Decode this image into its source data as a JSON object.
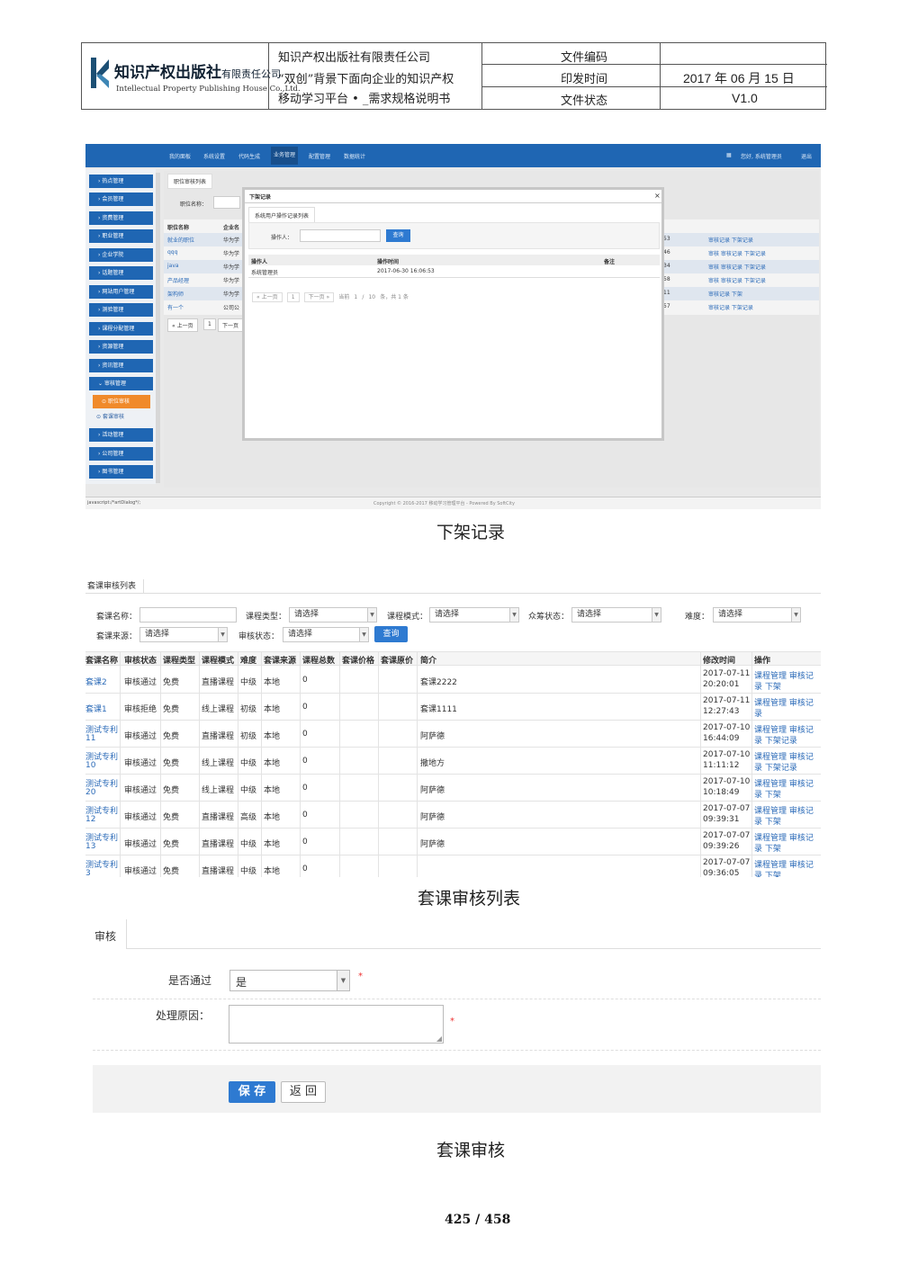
{
  "header": {
    "logo_cn": "知识产权出版社",
    "logo_cn_suffix": "有限责任公司",
    "logo_en": "Intellectual Property Publishing House Co.,Ltd.",
    "company": "知识产权出版社有限责任公司",
    "doc_title_line1": "“双创”背景下面向企业的知识产权",
    "doc_title_line2": "移动学习平台 • _需求规格说明书",
    "label_code": "文件编码",
    "label_date": "印发时间",
    "label_status": "文件状态",
    "value_code": "",
    "value_date": "2017 年 06 月 15 日",
    "value_status": "V1.0"
  },
  "shot1": {
    "nav": [
      "我的面板",
      "系统设置",
      "代码生成",
      "业务管理",
      "配置管理",
      "数据统计"
    ],
    "nav_active": "业务管理",
    "user": "您好, 系统管理员",
    "logout": "退出",
    "sidebar": [
      "热点管理",
      "会员管理",
      "资费管理",
      "职业管理",
      "企业学院",
      "话题管理",
      "网站用户管理",
      "测验管理",
      "课程分配管理",
      "资源管理",
      "资讯管理",
      "审核管理",
      "活动管理",
      "公司管理",
      "图书管理"
    ],
    "sidebar_sub": [
      "职位审核",
      "套课审核"
    ],
    "tab": "职位审核列表",
    "filter_label": "职位名称：",
    "col_name": "职位名称",
    "col_company": "企业名",
    "rows": [
      {
        "name": "就业的职位",
        "co": "华为学",
        "num": "53",
        "ops": "审核记录 下架记录"
      },
      {
        "name": "qqq",
        "co": "华为学",
        "num": "46",
        "ops": "审核 审核记录 下架记录"
      },
      {
        "name": "java",
        "co": "华为学",
        "num": "34",
        "ops": "审核 审核记录 下架记录"
      },
      {
        "name": "产品经理",
        "co": "华为学",
        "num": "58",
        "ops": "审核 审核记录 下架记录"
      },
      {
        "name": "架构师",
        "co": "华为学",
        "num": "11",
        "ops": "审核记录 下架"
      },
      {
        "name": "有一个",
        "co": "公司公",
        "num": "57",
        "ops": "审核记录 下架记录"
      }
    ],
    "pager": [
      "« 上一页",
      "1",
      "下一页"
    ],
    "modal": {
      "title": "下架记录",
      "close": "×",
      "tab": "系统用户操作记录列表",
      "filter_label": "操作人：",
      "query": "查询",
      "cols": [
        "操作人",
        "操作时间",
        "备注"
      ],
      "row": [
        "系统管理员",
        "2017-06-30 16:06:53",
        ""
      ],
      "pager": [
        "« 上一页",
        "1",
        "下一页 »",
        "当前",
        "1",
        "/",
        "10",
        "条，共 1 条"
      ]
    },
    "status_url": "javascript:/*artDialog*/;",
    "copyright": "Copyright © 2016-2017 移动学习管理平台 - Powered By SoftCity"
  },
  "caption1": "下架记录",
  "shot2": {
    "tab": "套课审核列表",
    "f_name": "套课名称：",
    "f_type": "课程类型：",
    "f_mode": "课程模式：",
    "f_crowd": "众筹状态：",
    "f_diff": "难度：",
    "f_source": "套课来源：",
    "f_status": "审核状态：",
    "placeholder": "请选择",
    "query": "查询",
    "cols": [
      "套课名称",
      "审核状态",
      "课程类型",
      "课程模式",
      "难度",
      "套课来源",
      "课程总数",
      "套课价格",
      "套课原价",
      "简介",
      "修改时间",
      "操作"
    ],
    "rows": [
      {
        "name": "套课2",
        "st": "审核通过",
        "ty": "免费",
        "mo": "直播课程",
        "di": "中级",
        "src": "本地",
        "cnt": "0",
        "intro": "套课2222",
        "t1": "2017-07-11",
        "t2": "20:20:01",
        "o1": "课程管理 审核记",
        "o2": "录 下架"
      },
      {
        "name": "套课1",
        "st": "审核拒绝",
        "ty": "免费",
        "mo": "线上课程",
        "di": "初级",
        "src": "本地",
        "cnt": "0",
        "intro": "套课1111",
        "t1": "2017-07-11",
        "t2": "12:27:43",
        "o1": "课程管理 审核记",
        "o2": "录"
      },
      {
        "name": "测试专利",
        "name2": "11",
        "st": "审核通过",
        "ty": "免费",
        "mo": "直播课程",
        "di": "初级",
        "src": "本地",
        "cnt": "0",
        "intro": "阿萨德",
        "t1": "2017-07-10",
        "t2": "16:44:09",
        "o1": "课程管理 审核记",
        "o2": "录 下架记录"
      },
      {
        "name": "测试专利",
        "name2": "10",
        "st": "审核通过",
        "ty": "免费",
        "mo": "线上课程",
        "di": "中级",
        "src": "本地",
        "cnt": "0",
        "intro": "撒地方",
        "t1": "2017-07-10",
        "t2": "11:11:12",
        "o1": "课程管理 审核记",
        "o2": "录 下架记录"
      },
      {
        "name": "测试专利",
        "name2": "20",
        "st": "审核通过",
        "ty": "免费",
        "mo": "线上课程",
        "di": "中级",
        "src": "本地",
        "cnt": "0",
        "intro": "阿萨德",
        "t1": "2017-07-10",
        "t2": "10:18:49",
        "o1": "课程管理 审核记",
        "o2": "录 下架"
      },
      {
        "name": "测试专利",
        "name2": "12",
        "st": "审核通过",
        "ty": "免费",
        "mo": "直播课程",
        "di": "高级",
        "src": "本地",
        "cnt": "0",
        "intro": "阿萨德",
        "t1": "2017-07-07",
        "t2": "09:39:31",
        "o1": "课程管理 审核记",
        "o2": "录 下架"
      },
      {
        "name": "测试专利",
        "name2": "13",
        "st": "审核通过",
        "ty": "免费",
        "mo": "直播课程",
        "di": "中级",
        "src": "本地",
        "cnt": "0",
        "intro": "阿萨德",
        "t1": "2017-07-07",
        "t2": "09:39:26",
        "o1": "课程管理 审核记",
        "o2": "录 下架"
      },
      {
        "name": "测试专利",
        "name2": "3",
        "st": "审核通过",
        "ty": "免费",
        "mo": "直播课程",
        "di": "中级",
        "src": "本地",
        "cnt": "0",
        "intro": "",
        "t1": "2017-07-07",
        "t2": "09:36:05",
        "o1": "课程管理 审核记",
        "o2": "录 下架"
      }
    ]
  },
  "caption2": "套课审核列表",
  "shot3": {
    "tab": "审核",
    "label_pass": "是否通过",
    "value_pass": "是",
    "label_reason": "处理原因：",
    "required": "*",
    "save": "保 存",
    "back": "返 回"
  },
  "caption3": "套课审核",
  "page": "425 / 458"
}
